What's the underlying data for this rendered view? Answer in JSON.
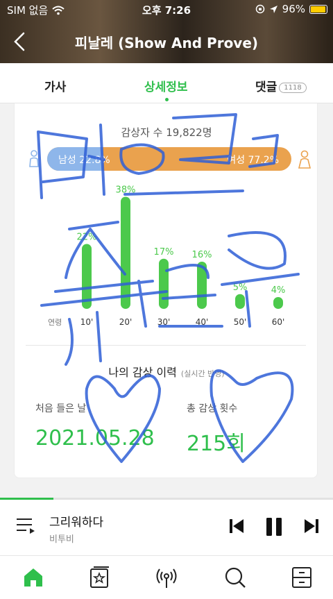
{
  "status_bar": {
    "carrier": "SIM 없음",
    "time": "오후 7:26",
    "battery": "96%",
    "battery_level": 0.96
  },
  "header": {
    "title": "피날레 (Show And Prove)",
    "back_icon": "chevron-left-icon"
  },
  "tabs": [
    {
      "label": "가사"
    },
    {
      "label": "상세정보",
      "active": true
    },
    {
      "label": "댓글",
      "badge": "1118"
    }
  ],
  "stats": {
    "listeners": "감상자 수 19,822명",
    "male_label": "남성 22.8%",
    "female_label": "여성 77.2%",
    "male_share": 0.228,
    "accent_male": "#8eb6ea",
    "accent_female": "#eaa24e"
  },
  "chart_data": {
    "type": "bar",
    "xlabel": "연령",
    "categories": [
      "10'",
      "20'",
      "30'",
      "40'",
      "50'",
      "60'"
    ],
    "values": [
      22,
      38,
      17,
      16,
      5,
      4
    ],
    "value_labels": [
      "22%",
      "38%",
      "17%",
      "16%",
      "5%",
      "4%"
    ],
    "color": "#4cc94c"
  },
  "history": {
    "title": "나의 감상 이력",
    "note": "(실시간 반영)",
    "first_label": "처음 들은 날",
    "first_value": "2021.05.28",
    "count_label": "총 감상 횟수",
    "count_value": "215회"
  },
  "player": {
    "song": "그리워하다",
    "artist": "비투비",
    "progress": 0.16
  },
  "bottom_nav": [
    {
      "icon": "home-icon",
      "active": true
    },
    {
      "icon": "star-card-icon"
    },
    {
      "icon": "podcast-icon"
    },
    {
      "icon": "search-icon"
    },
    {
      "icon": "library-icon"
    }
  ],
  "accent": "#2fbf4c"
}
